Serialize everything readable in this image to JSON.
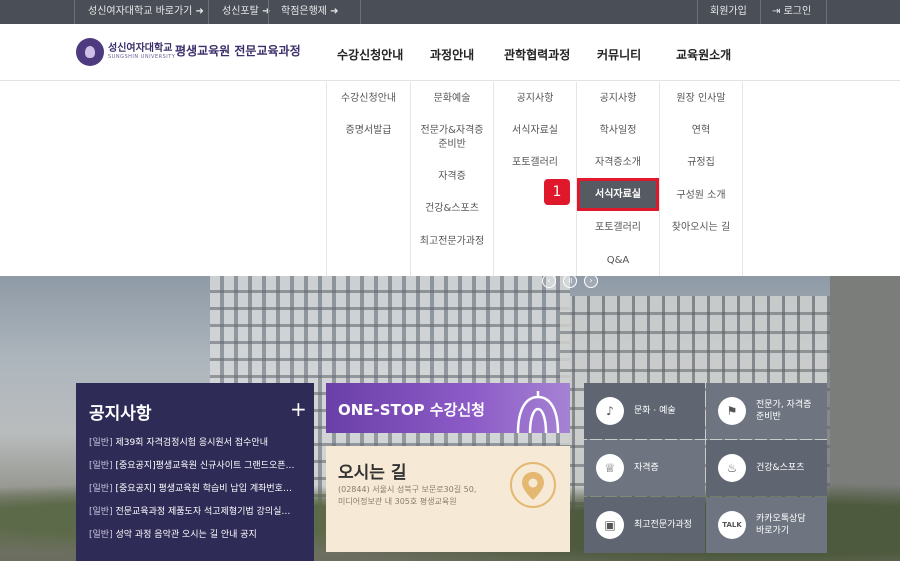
{
  "topbar": {
    "links": [
      "성신여자대학교 바로가기 ➜",
      "성신포탈 ➜",
      "학점은행제 ➜"
    ],
    "join": "회원가입",
    "login": "로그인"
  },
  "header": {
    "univ_name": "성신여자대학교",
    "univ_en": "SUNGSHIN UNIVERSITY",
    "title": "평생교육원 전문교육과정",
    "nav": [
      "수강신청안내",
      "과정안내",
      "관학협력과정",
      "커뮤니티",
      "교육원소개"
    ]
  },
  "dropdown": {
    "col1": [
      "수강신청안내",
      "증명서발급"
    ],
    "col2": [
      "문화예술",
      "전문가&자격증\n준비반",
      "자격증",
      "건강&스포츠",
      "최고전문가과정"
    ],
    "col3": [
      "공지사항",
      "서식자료실",
      "포토갤러리"
    ],
    "col4": [
      "공지사항",
      "학사일정",
      "자격증소개",
      "서식자료실",
      "포토갤러리",
      "Q&A"
    ],
    "col5": [
      "원장 인사말",
      "연혁",
      "규정집",
      "구성원 소개",
      "찾아오시는 길"
    ],
    "badge": "1"
  },
  "notice": {
    "title": "공지사항",
    "plus": "+",
    "items": [
      {
        "cat": "[일반]",
        "text": " 제39회 자격검정시험 응시원서 접수안내"
      },
      {
        "cat": "[일반]",
        "text": " [중요공지]평생교육원 신규사이트 그랜드오픈…"
      },
      {
        "cat": "[일반]",
        "text": " [중요공지] 평생교육원 학습비 납입 계좌번호…"
      },
      {
        "cat": "[일반]",
        "text": " 전문교육과정 제품도자 석고제형기법 강의실…"
      },
      {
        "cat": "[일반]",
        "text": " 성악 과정 음악관 오시는 길 안내 공지"
      }
    ]
  },
  "onestop": {
    "label": "ONE-STOP 수강신청"
  },
  "directions": {
    "title": "오시는 길",
    "address": "(02844) 서울시 성북구 보문로30길 50, 미디어정보관 내 305호 평생교육원"
  },
  "quick": [
    {
      "label": "문화 · 예술",
      "icon": "music-note-icon"
    },
    {
      "label": "전문가, 자격증\n준비반",
      "icon": "flag-icon"
    },
    {
      "label": "자격증",
      "icon": "trophy-icon"
    },
    {
      "label": "건강&스포츠",
      "icon": "sports-icon"
    },
    {
      "label": "최고전문가과정",
      "icon": "certificate-icon"
    },
    {
      "label": "카카오톡상담\n바로가기",
      "icon": "talk-icon"
    }
  ],
  "colors": {
    "topbar": "#4a4e57",
    "notice": "#2f2b57",
    "onestop": "#7a4bb8",
    "highlight": "#e0182c"
  }
}
